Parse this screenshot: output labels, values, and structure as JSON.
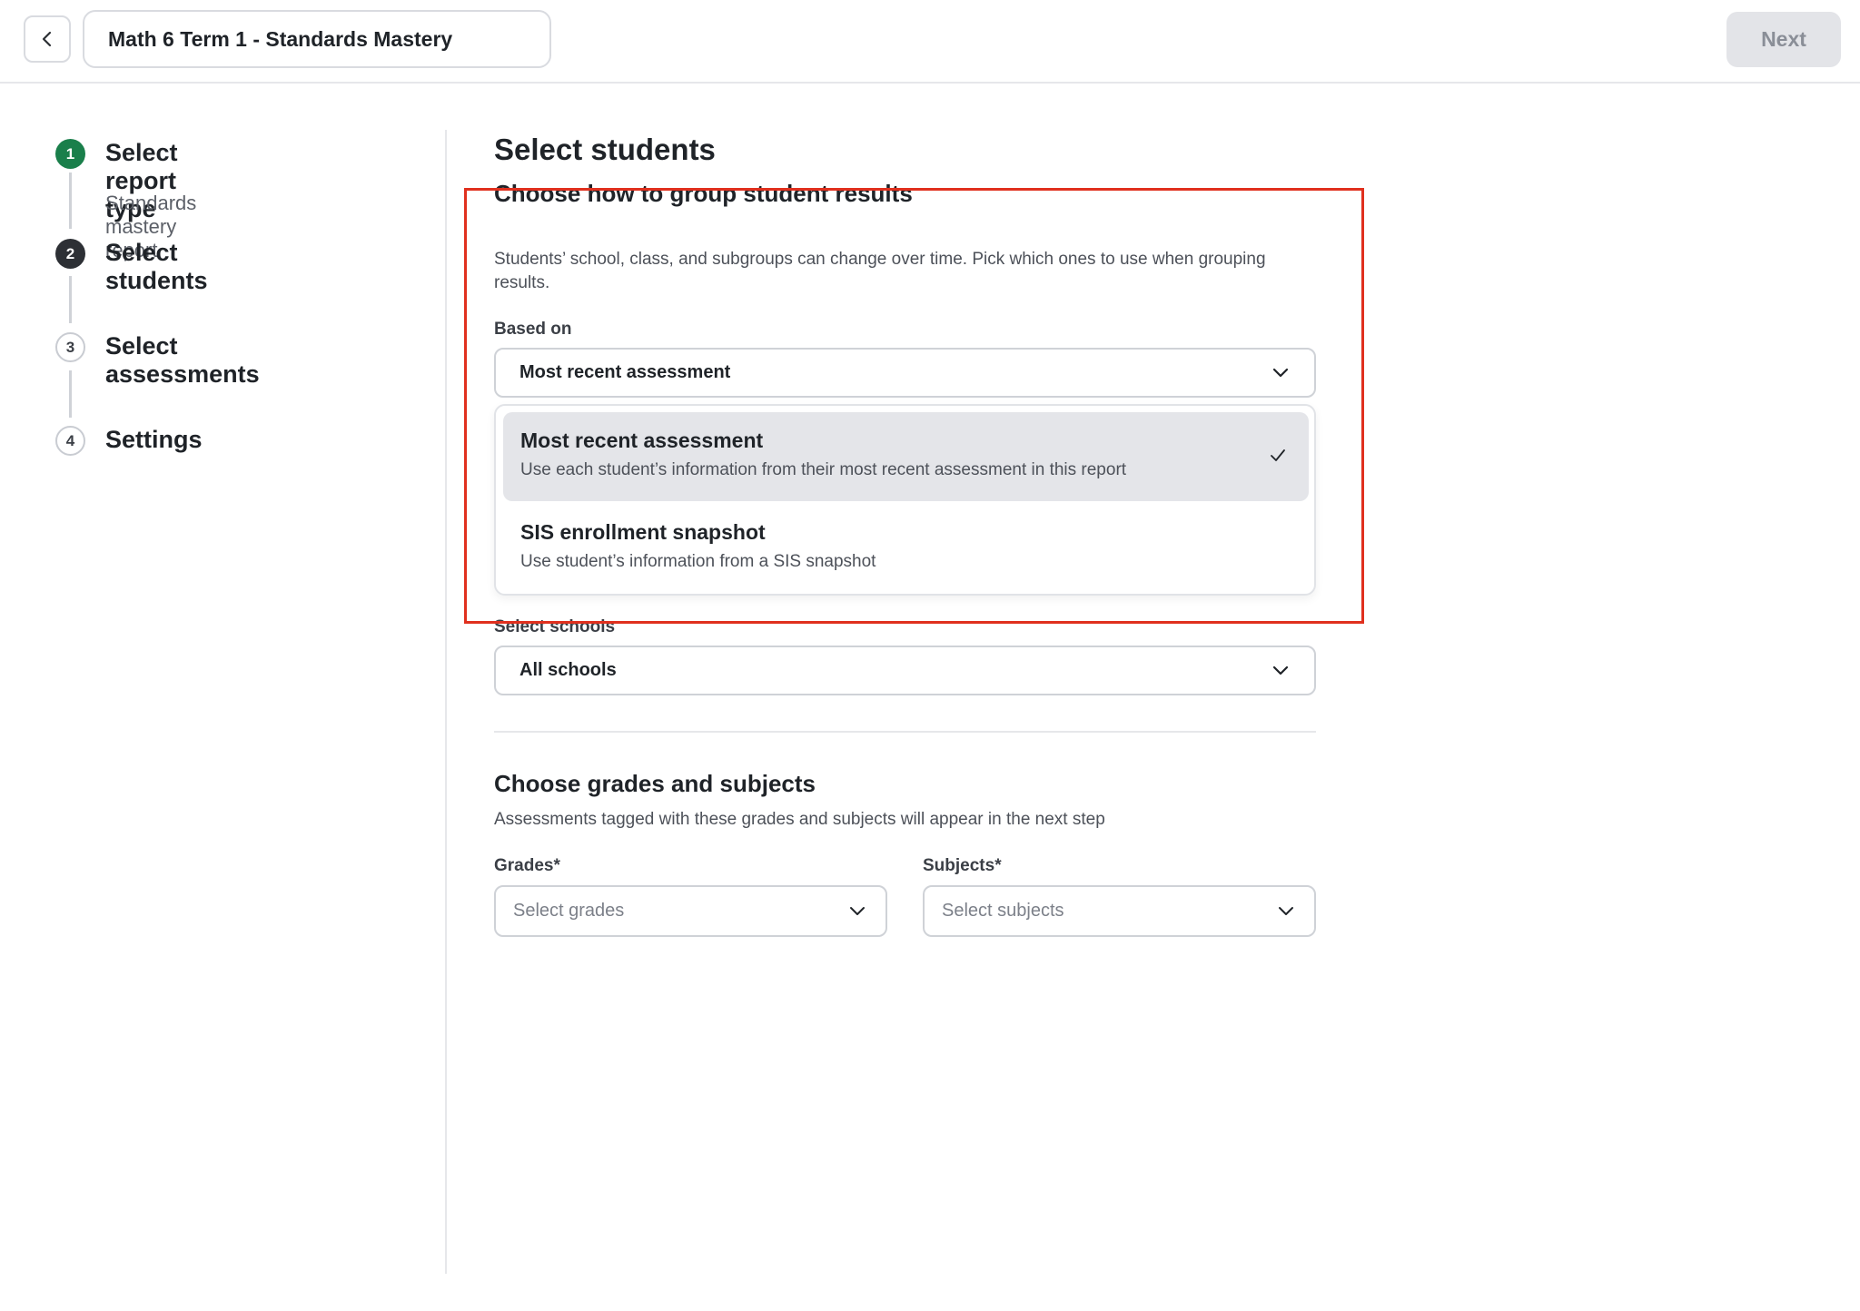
{
  "header": {
    "back_icon": "chevron-left-icon",
    "report_name": "Math 6 Term 1 - Standards Mastery",
    "next_label": "Next"
  },
  "stepper": {
    "steps": [
      {
        "number": "1",
        "label": "Select report type",
        "sublabel": "Standards mastery report",
        "state": "done"
      },
      {
        "number": "2",
        "label": "Select students",
        "state": "active"
      },
      {
        "number": "3",
        "label": "Select assessments",
        "state": "todo"
      },
      {
        "number": "4",
        "label": "Settings",
        "state": "todo"
      }
    ],
    "colors": {
      "done": "#1a7f4b",
      "active": "#2d3035"
    }
  },
  "main": {
    "title": "Select students",
    "grouping": {
      "title": "Choose how to group student results",
      "description": "Students’ school, class, and subgroups can change over time. Pick which ones to use when grouping results.",
      "based_on_label": "Based on",
      "based_on_value": "Most recent assessment",
      "options": [
        {
          "title": "Most recent assessment",
          "description": "Use each student’s information from their most recent assessment in this report",
          "selected": true
        },
        {
          "title": "SIS enrollment snapshot",
          "description": "Use student’s information from a SIS snapshot",
          "selected": false
        }
      ]
    },
    "schools": {
      "label": "Select schools",
      "value": "All schools"
    },
    "grades_subjects": {
      "title": "Choose grades and subjects",
      "description": "Assessments tagged with these grades and subjects will appear in the next step",
      "grades_label": "Grades*",
      "grades_placeholder": "Select grades",
      "subjects_label": "Subjects*",
      "subjects_placeholder": "Select subjects"
    },
    "highlight_color": "#e0301e"
  }
}
